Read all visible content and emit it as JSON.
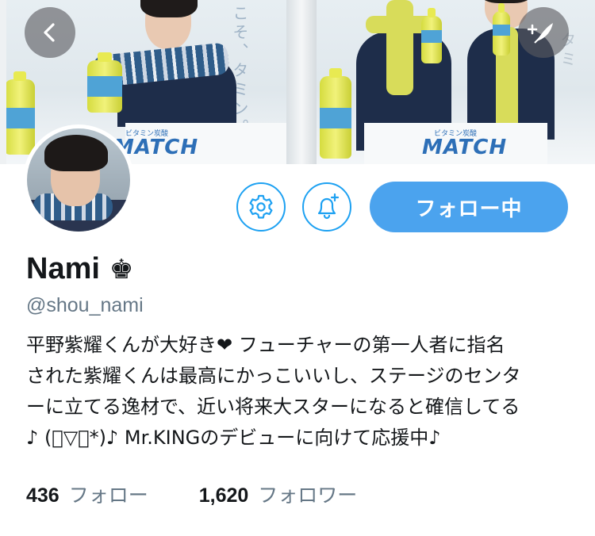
{
  "header": {
    "left_poster_text": "こそ、タミン。",
    "left_logo": "MATCH",
    "left_logo_sub": "ビタミン炭酸",
    "right_poster_text": "タミ",
    "right_logo": "MATCH",
    "right_logo_sub": "ビタミン炭酸",
    "bottle_label": "MATCH"
  },
  "actions": {
    "follow_label": "フォロー中"
  },
  "profile": {
    "name": "Nami",
    "crown_glyph": "♚",
    "handle": "@shou_nami",
    "bio_lines": [
      "平野紫耀くんが大好き❤ フューチャーの第一人者に指名",
      "された紫耀くんは最高にかっこいいし、ステージのセンタ",
      "ーに立てる逸材で、近い将来大スターになると確信してる",
      "♪ (ﾟ▽ﾟ*)♪ Mr.KINGのデビューに向けて応援中♪"
    ]
  },
  "stats": {
    "following_count": "436",
    "following_label": "フォロー",
    "followers_count": "1,620",
    "followers_label": "フォロワー"
  },
  "icons": {
    "back": "chevron-left-icon",
    "compose": "compose-feather-icon",
    "settings": "gear-icon",
    "notify": "bell-plus-icon"
  },
  "colors": {
    "accent": "#1da1f2",
    "follow_button": "#4ba3ee",
    "text_primary": "#14171a",
    "text_secondary": "#657786"
  }
}
